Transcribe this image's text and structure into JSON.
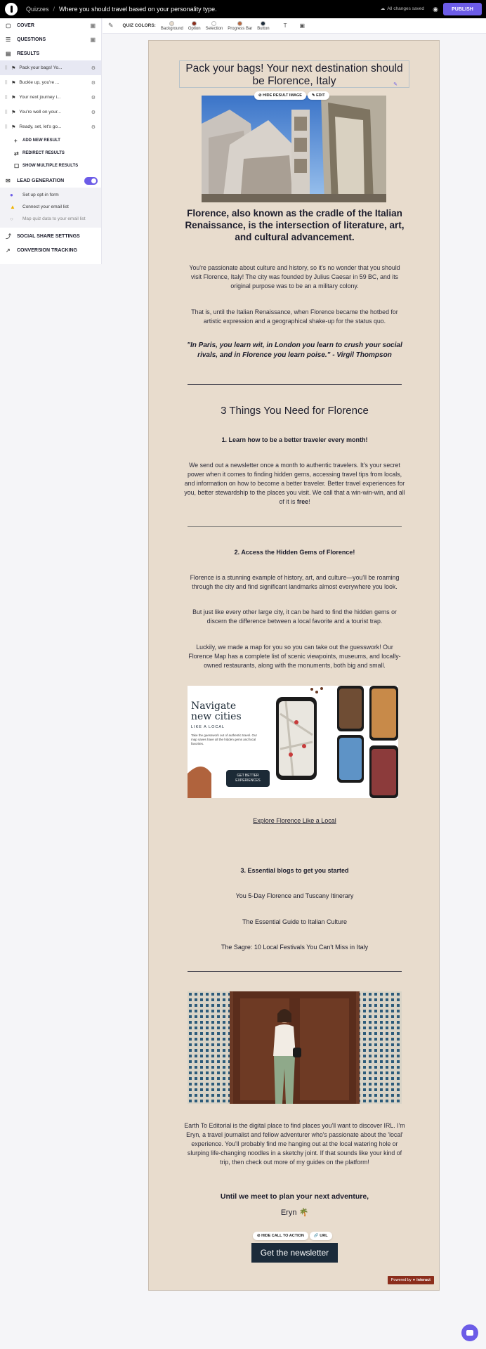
{
  "topbar": {
    "back_label": "Quizzes",
    "separator": "/",
    "quiz_title": "Where you should travel based on your personality type.",
    "save_status": "All changes saved",
    "publish_label": "PUBLISH"
  },
  "sidebar": {
    "cover_label": "COVER",
    "questions_label": "QUESTIONS",
    "results_label": "RESULTS",
    "results": [
      {
        "label": "Pack your bags! Yo..."
      },
      {
        "label": "Buckle up, you're ..."
      },
      {
        "label": "Your next journey i..."
      },
      {
        "label": "You're well on your..."
      },
      {
        "label": "Ready, set, let's go..."
      }
    ],
    "actions": {
      "add_new": "ADD NEW RESULT",
      "redirect": "REDIRECT RESULTS",
      "show_multiple": "SHOW MULTIPLE RESULTS"
    },
    "lead_generation_label": "LEAD GENERATION",
    "lead_items": [
      {
        "label": "Set up opt-in form"
      },
      {
        "label": "Connect your email list"
      },
      {
        "label": "Map quiz data to your email list"
      }
    ],
    "social_share_label": "SOCIAL SHARE SETTINGS",
    "conversion_label": "CONVERSION TRACKING"
  },
  "toolbar": {
    "quiz_colors_label": "QUIZ COLORS:",
    "swatches": [
      {
        "label": "Background",
        "color": "#e8dccd"
      },
      {
        "label": "Option",
        "color": "#8b2d1b"
      },
      {
        "label": "Selection",
        "color": "#ffffff"
      },
      {
        "label": "Progress Bar",
        "color": "#b8673f"
      },
      {
        "label": "Button",
        "color": "#1b2b3a"
      }
    ]
  },
  "result": {
    "title": "Pack your bags! Your next destination should be Florence, Italy",
    "hide_image_label": "HIDE RESULT IMAGE",
    "edit_label": "EDIT",
    "subtitle": "Florence, also known as the cradle of the Italian Renaissance, is the intersection of literature, art, and cultural advancement.",
    "para1": "You're passionate about culture and history, so it's no wonder that you should visit Florence, Italy! The city was founded by Julius Caesar in 59 BC, and its original purpose was to be an a military colony.",
    "para2": "That is, until the Italian Renaissance, when Florence became the hotbed for artistic expression and a geographical shake-up for the status quo.",
    "quote": "\"In Paris, you learn wit, in London you learn to crush your social rivals, and in Florence you learn poise.\" - Virgil Thompson",
    "things_heading": "3 Things You Need for Florence",
    "item1_heading": "1. Learn how to be a better traveler every month!",
    "item1_text": "We send out a newsletter once a month to authentic travelers. It's your secret power when it comes to finding hidden gems, accessing travel tips from locals, and information on how to become a better traveler. Better travel experiences for you, better stewardship to the places you visit. We call that a win-win-win, and all of it is",
    "item1_free": "free",
    "item1_end": "!",
    "item2_heading": "2. Access the Hidden Gems of Florence!",
    "item2_text1": "Florence is a stunning example of history, art, and culture—you'll be roaming through the city and find significant landmarks almost everywhere you look.",
    "item2_text2": "But just like every other large city, it can be hard to find the hidden gems or discern the difference between a local favorite and a tourist trap.",
    "item2_text3": "Luckily, we made a map for you so you can take out the guesswork! Our Florence Map has a complete list of scenic viewpoints, museums, and locally-owned restaurants, along with the monuments, both big and small.",
    "promo": {
      "title_line1": "Navigate",
      "title_line2": "new cities",
      "tagline": "LIKE A LOCAL",
      "body": "Take the guesswork out of authentic travel. Our map saves have all the hidden gems and local favorites.",
      "button_line1": "GET BETTER",
      "button_line2": "EXPERIENCES"
    },
    "explore_link": "Explore Florence Like a Local",
    "item3_heading": "3. Essential blogs to get you started",
    "blogs": [
      {
        "label": "You 5-Day Florence and Tuscany Itinerary"
      },
      {
        "label": "The Essential Guide to Italian Culture"
      },
      {
        "label": "The Sagre: 10 Local Festivals You Can't Miss in Italy"
      }
    ],
    "about_text": "Earth To Editorial is the digital place to find places you'll want to discover IRL. I'm Eryn, a travel journalist and fellow adventurer who's passionate about the 'local' experience. You'll probably find me hanging out at the local watering hole or slurping life-changing noodles in a sketchy joint. If that sounds like your kind of trip, then check out more of my guides on the platform!",
    "signoff": "Until we meet to plan your next adventure,",
    "signature": "Eryn 🌴",
    "hide_cta_label": "HIDE CALL TO ACTION",
    "url_label": "URL",
    "cta_label": "Get the newsletter",
    "powered_by": "Powered by",
    "powered_brand": "interact"
  }
}
